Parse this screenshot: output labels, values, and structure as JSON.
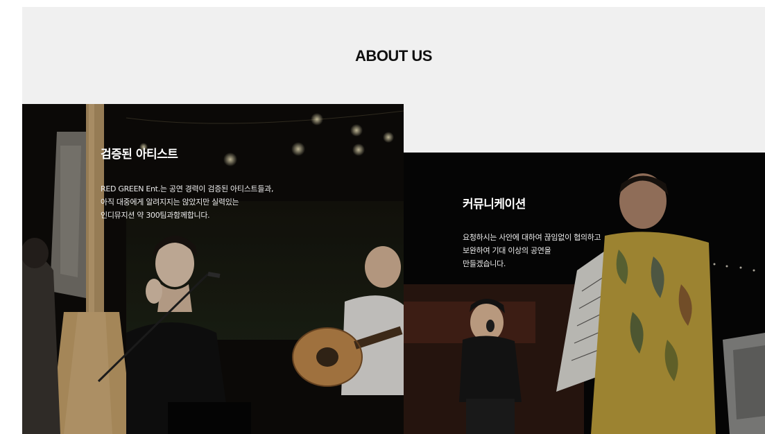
{
  "about": {
    "title": "ABOUT US"
  },
  "cards": [
    {
      "heading": "검증된 아티스트",
      "lines": [
        "RED GREEN Ent.는 공연 경력이 검증된 아티스트들과,",
        "아직 대중에게 알려지지는 않았지만 실력있는",
        "인디뮤지션 약 300팀과함께합니다."
      ]
    },
    {
      "heading": "커뮤니케이션",
      "lines": [
        "요청하시는 사안에 대하여 끊임없이 협의하고",
        "보완하여 기대 이상의 공연을",
        "만들겠습니다."
      ]
    }
  ],
  "colors": {
    "band": "#f0f0f0",
    "heading_text": "#111111",
    "card_text": "#ffffff"
  }
}
